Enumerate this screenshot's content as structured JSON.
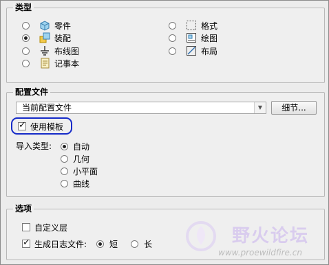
{
  "type_group": {
    "title": "类型",
    "left_options": [
      {
        "label": "零件",
        "icon": "part-icon",
        "selected": false
      },
      {
        "label": "装配",
        "icon": "assembly-icon",
        "selected": true
      },
      {
        "label": "布线图",
        "icon": "harness-diagram-icon",
        "selected": false
      },
      {
        "label": "记事本",
        "icon": "notebook-icon",
        "selected": false
      }
    ],
    "right_options": [
      {
        "label": "格式",
        "icon": "format-icon",
        "selected": false
      },
      {
        "label": "绘图",
        "icon": "drawing-icon",
        "selected": false
      },
      {
        "label": "布局",
        "icon": "layout-icon",
        "selected": false
      }
    ]
  },
  "config_group": {
    "title": "配置文件",
    "profile_value": "当前配置文件",
    "details_button": "细节...",
    "use_template_label": "使用模板",
    "use_template_checked": true,
    "import_type_label": "导入类型:",
    "import_options": [
      {
        "label": "自动",
        "selected": true
      },
      {
        "label": "几何",
        "selected": false
      },
      {
        "label": "小平面",
        "selected": false
      },
      {
        "label": "曲线",
        "selected": false
      }
    ]
  },
  "options_group": {
    "title": "选项",
    "custom_layer_label": "自定义层",
    "custom_layer_checked": false,
    "log_file_label": "生成日志文件:",
    "log_file_checked": true,
    "log_short_label": "短",
    "log_short_selected": true,
    "log_long_label": "长",
    "log_long_selected": false
  },
  "watermark": {
    "text": "野火论坛",
    "url": "www.proewildfire.cn"
  },
  "colors": {
    "highlight": "#1429c8",
    "watermark": "#d7c9ee"
  }
}
